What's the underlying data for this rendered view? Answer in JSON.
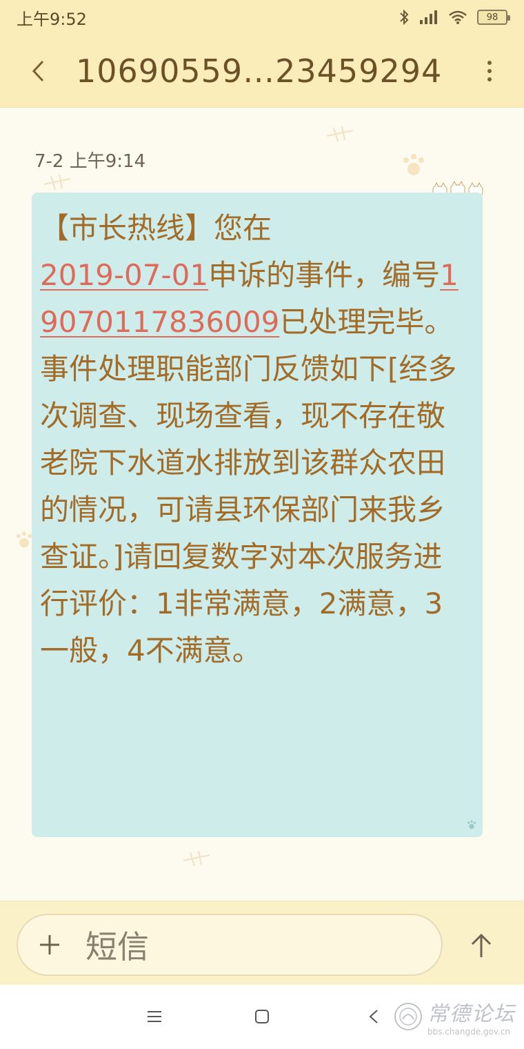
{
  "status_bar": {
    "time": "上午9:52",
    "battery": "98"
  },
  "header": {
    "title": "10690559…23459294"
  },
  "message": {
    "timestamp": "7-2 上午9:14",
    "seg1": "【市长热线】您在",
    "date_link": "2019-07-01",
    "seg2": "申诉的事件，编号",
    "number_link": "19070117836009",
    "seg3": "已处理完毕。事件处理职能部门反馈如下[经多次调查、现场查看，现不存在敬老院下水道水排放到该群众农田的情况，可请县环保部门来我乡查证。]请回复数字对本次服务进行评价：1非常满意，2满意，3一般，4不满意。"
  },
  "input_bar": {
    "placeholder": "短信"
  },
  "watermark": {
    "title": "常德论坛",
    "url": "bbs.changde.gov.cn"
  },
  "colors": {
    "header_bg": "#fbedb9",
    "bubble_bg": "#cdecea",
    "message_text": "#a26b28",
    "link": "#e06a5a",
    "title_text": "#6b5028"
  },
  "icons": {
    "back": "chevron-left-icon",
    "more": "more-vertical-icon",
    "plus": "plus-icon",
    "send": "arrow-up-icon",
    "nav_menu": "menu-icon",
    "nav_home": "square-icon",
    "nav_back": "triangle-back-icon"
  }
}
